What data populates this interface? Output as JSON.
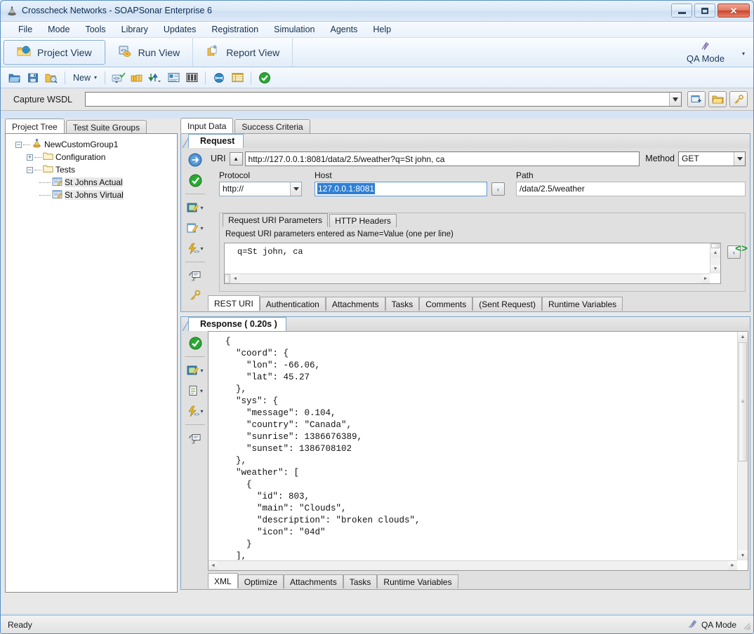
{
  "window": {
    "title": "Crosscheck Networks - SOAPSonar Enterprise 6",
    "minimize_label": "Minimize",
    "maximize_label": "Maximize",
    "close_label": "✕"
  },
  "menu": {
    "items": [
      "File",
      "Mode",
      "Tools",
      "Library",
      "Updates",
      "Registration",
      "Simulation",
      "Agents",
      "Help"
    ]
  },
  "viewbar": {
    "tabs": [
      {
        "label": "Project View",
        "icon": "folder-globe-icon",
        "active": true
      },
      {
        "label": "Run View",
        "icon": "run-code-icon",
        "active": false
      },
      {
        "label": "Report View",
        "icon": "report-icon",
        "active": false
      }
    ],
    "mode_label": "QA Mode",
    "mode_icon": "qa-mode-icon",
    "mode_caret": "▾"
  },
  "toolbar": {
    "buttons": [
      {
        "name": "open-icon",
        "glyph": "open"
      },
      {
        "name": "save-icon",
        "glyph": "save"
      },
      {
        "name": "save-as-icon",
        "glyph": "saveas"
      }
    ],
    "new_label": "New",
    "new_caret": "▾",
    "buttons2": [
      {
        "name": "new-wsdl-icon",
        "glyph": "wsdl"
      },
      {
        "name": "packages-icon",
        "glyph": "packages"
      },
      {
        "name": "import-export-icon",
        "glyph": "arrows"
      },
      {
        "name": "properties-icon",
        "glyph": "props"
      },
      {
        "name": "columns-icon",
        "glyph": "columns"
      }
    ],
    "buttons3": [
      {
        "name": "globe-icon",
        "glyph": "globe"
      },
      {
        "name": "grid-icon",
        "glyph": "grid"
      }
    ],
    "buttons4": [
      {
        "name": "run-check-icon",
        "glyph": "check"
      }
    ]
  },
  "capture": {
    "label": "Capture WSDL",
    "value": "",
    "placeholder": "",
    "dropdown_caret": "▾",
    "buttons": [
      {
        "name": "add-wsdl-button",
        "icon": "add-window-icon"
      },
      {
        "name": "open-wsdl-button",
        "icon": "folder-icon"
      },
      {
        "name": "keys-button",
        "icon": "key-icon"
      }
    ]
  },
  "left_panel": {
    "tabs": [
      {
        "label": "Project Tree",
        "active": true
      },
      {
        "label": "Test Suite Groups",
        "active": false
      }
    ],
    "tree": [
      {
        "label": "NewCustomGroup1",
        "level": 0,
        "expander": "−",
        "icon": "custom-group-icon",
        "selected": false
      },
      {
        "label": "Configuration",
        "level": 1,
        "expander": "+",
        "icon": "folder-icon",
        "selected": false
      },
      {
        "label": "Tests",
        "level": 1,
        "expander": "−",
        "icon": "folder-icon",
        "selected": false
      },
      {
        "label": "St Johns Actual",
        "level": 2,
        "expander": "",
        "icon": "test-case-icon",
        "selected": true
      },
      {
        "label": "St Johns Virtual",
        "level": 2,
        "expander": "",
        "icon": "test-case-icon",
        "selected": true
      }
    ]
  },
  "right_panel": {
    "top_tabs": [
      {
        "label": "Input Data",
        "active": true
      },
      {
        "label": "Success Criteria",
        "active": false
      }
    ],
    "request": {
      "group_title": "Request",
      "vtoolbar": [
        {
          "name": "send-request-icon",
          "caret": false
        },
        {
          "name": "validate-ok-icon",
          "caret": false
        },
        {
          "name": "edit-xml-icon",
          "caret": true
        },
        {
          "name": "edit-note-icon",
          "caret": true
        },
        {
          "name": "script-icon",
          "caret": true
        },
        {
          "name": "comment-icon",
          "caret": false
        },
        {
          "name": "key-icon",
          "caret": false
        }
      ],
      "uri_label": "URI",
      "uri_collapse_glyph": "▲",
      "uri_value": "http://127.0.0.1:8081/data/2.5/weather?q=St john, ca",
      "method_label": "Method",
      "method_value": "GET",
      "method_caret": "▾",
      "protocol_label": "Protocol",
      "protocol_value": "http://",
      "protocol_caret": "▾",
      "host_label": "Host",
      "host_value": "127.0.0.1:8081",
      "host_expand_glyph": "‹",
      "path_label": "Path",
      "path_value": "/data/2.5/weather",
      "param_tabs": [
        {
          "label": "Request URI Parameters",
          "active": true
        },
        {
          "label": "HTTP Headers",
          "active": false
        }
      ],
      "params_hint": "Request URI parameters entered as Name=Value  (one per line)",
      "params_value": "q=St john, ca",
      "params_expand_glyph": "‹",
      "bottom_tabs": [
        {
          "label": "REST URI",
          "active": true
        },
        {
          "label": "Authentication",
          "active": false
        },
        {
          "label": "Attachments",
          "active": false
        },
        {
          "label": "Tasks",
          "active": false
        },
        {
          "label": "Comments",
          "active": false
        },
        {
          "label": "(Sent Request)",
          "active": false
        },
        {
          "label": "Runtime Variables",
          "active": false
        }
      ]
    },
    "response": {
      "group_title": "Response ( 0.20s )",
      "vtoolbar": [
        {
          "name": "validate-ok-icon",
          "caret": false
        },
        {
          "name": "edit-xml-icon",
          "caret": true
        },
        {
          "name": "document-icon",
          "caret": true
        },
        {
          "name": "script-icon",
          "caret": true
        },
        {
          "name": "comment-icon",
          "caret": false
        }
      ],
      "body": "{\n  \"coord\": {\n    \"lon\": -66.06,\n    \"lat\": 45.27\n  },\n  \"sys\": {\n    \"message\": 0.104,\n    \"country\": \"Canada\",\n    \"sunrise\": 1386676389,\n    \"sunset\": 1386708102\n  },\n  \"weather\": [\n    {\n      \"id\": 803,\n      \"main\": \"Clouds\",\n      \"description\": \"broken clouds\",\n      \"icon\": \"04d\"\n    }\n  ],",
      "code_marker": "<>",
      "bottom_tabs": [
        {
          "label": "XML",
          "active": true
        },
        {
          "label": "Optimize",
          "active": false
        },
        {
          "label": "Attachments",
          "active": false
        },
        {
          "label": "Tasks",
          "active": false
        },
        {
          "label": "Runtime Variables",
          "active": false
        }
      ]
    }
  },
  "statusbar": {
    "message": "Ready",
    "mode_label": "QA Mode",
    "mode_icon": "qa-mode-icon"
  },
  "colors": {
    "accent_blue": "#2f7fd4",
    "frame_blue": "#7ea7ce",
    "green_ok": "#2aa832",
    "title_blue": "#0b2c54"
  }
}
